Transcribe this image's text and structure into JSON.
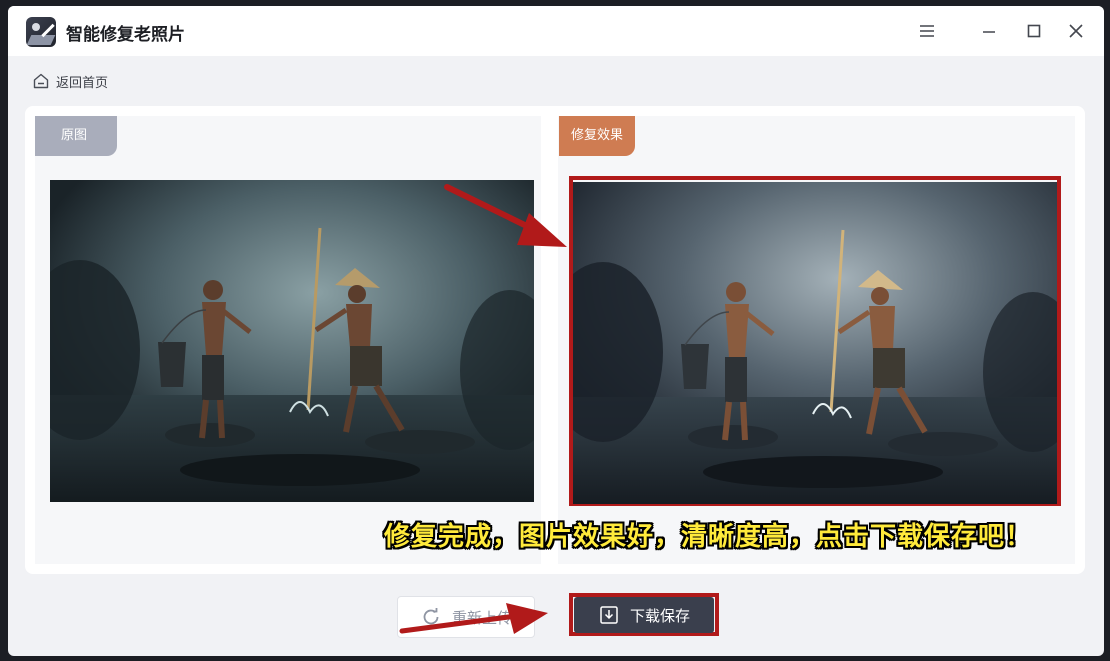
{
  "app": {
    "title": "智能修复老照片",
    "icons": {
      "menu": "menu-icon",
      "minimize": "minimize-icon",
      "maximize": "maximize-icon",
      "close": "close-icon"
    }
  },
  "nav": {
    "back_label": "返回首页",
    "back_icon": "home-icon"
  },
  "compare": {
    "original_label": "原图",
    "result_label": "修复效果"
  },
  "caption": "修复完成，图片效果好，清晰度高，点击下载保存吧！",
  "actions": {
    "reupload_label": "重新上传",
    "reupload_icon": "refresh-icon",
    "download_label": "下载保存",
    "download_icon": "download-icon"
  },
  "colors": {
    "original_tag": "#a9adbb",
    "result_tag": "#cf7c52",
    "highlight": "#b11a1a",
    "caption": "#ffea3b",
    "download_button": "#3a3f4d"
  }
}
